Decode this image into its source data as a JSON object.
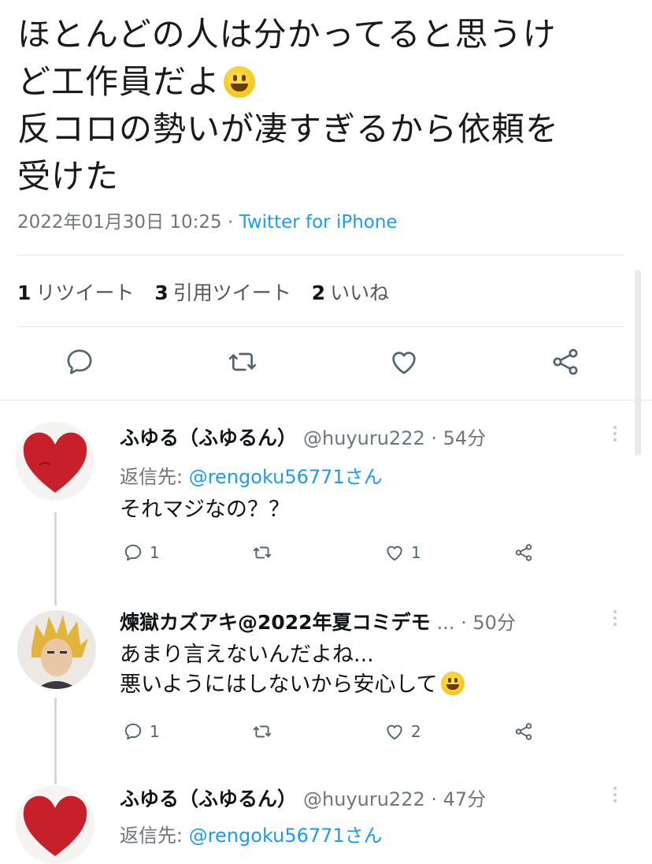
{
  "tweet": {
    "lines": [
      "ほとんどの人は分かってると思うけ",
      "ど工作員だよ",
      "反コロの勢いが凄すぎるから依頼を",
      "受けた"
    ],
    "timestamp": "2022年01月30日 10:25",
    "separator": " · ",
    "source": "Twitter for iPhone"
  },
  "stats": [
    {
      "count": "1",
      "label": "リツイート"
    },
    {
      "count": "3",
      "label": "引用ツイート"
    },
    {
      "count": "2",
      "label": "いいね"
    }
  ],
  "action_icons": [
    "reply-icon",
    "retweet-icon",
    "like-icon",
    "share-icon"
  ],
  "replies": [
    {
      "name": "ふゆる（ふゆるん）",
      "handle": "@huyuru222",
      "time": "· 54分",
      "reply_to_prefix": "返信先: ",
      "reply_to": "@rengoku56771さん",
      "body": [
        "それマジなの？？"
      ],
      "reply_count": "1",
      "like_count": "1"
    },
    {
      "name": "煉獄カズアキ@2022年夏コミデモ",
      "handle": "...",
      "time": "· 50分",
      "body": [
        "あまり言えないんだよね...",
        "悪いようにはしないから安心して"
      ],
      "reply_count": "1",
      "like_count": "2"
    },
    {
      "name": "ふゆる（ふゆるん）",
      "handle": "@huyuru222",
      "time": "· 47分",
      "reply_to_prefix": "返信先: ",
      "reply_to": "@rengoku56771さん"
    }
  ],
  "colors": {
    "accent": "#1d9bf0",
    "text": "#0f1419",
    "muted": "#6e767d",
    "heart": "#c8202a"
  }
}
